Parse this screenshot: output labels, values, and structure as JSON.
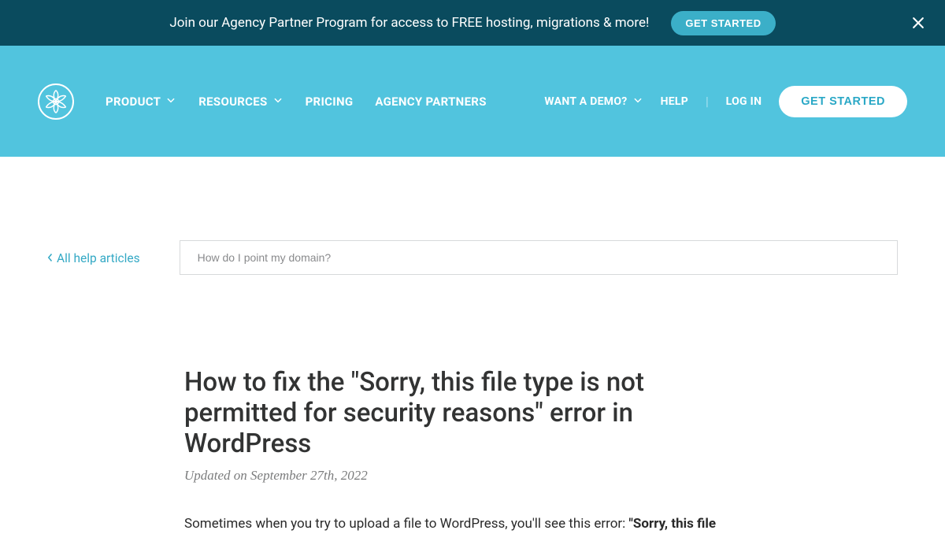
{
  "promo": {
    "text": "Join our Agency Partner Program for access to FREE hosting, migrations & more!",
    "button": "GET STARTED"
  },
  "nav": {
    "product": "PRODUCT",
    "resources": "RESOURCES",
    "pricing": "PRICING",
    "agency": "AGENCY PARTNERS",
    "demo": "WANT A DEMO?",
    "help": "HELP",
    "login": "LOG IN",
    "cta": "GET STARTED"
  },
  "help_link": "All help articles",
  "search": {
    "placeholder": "How do I point my domain?"
  },
  "article": {
    "title": "How to fix the \"Sorry, this file type is not permitted for security reasons\" error in WordPress",
    "updated": "Updated on September 27th, 2022",
    "body_prefix": "Sometimes when you try to upload a file to WordPress, you'll see this error: ",
    "body_bold": "\"Sorry, this file"
  }
}
